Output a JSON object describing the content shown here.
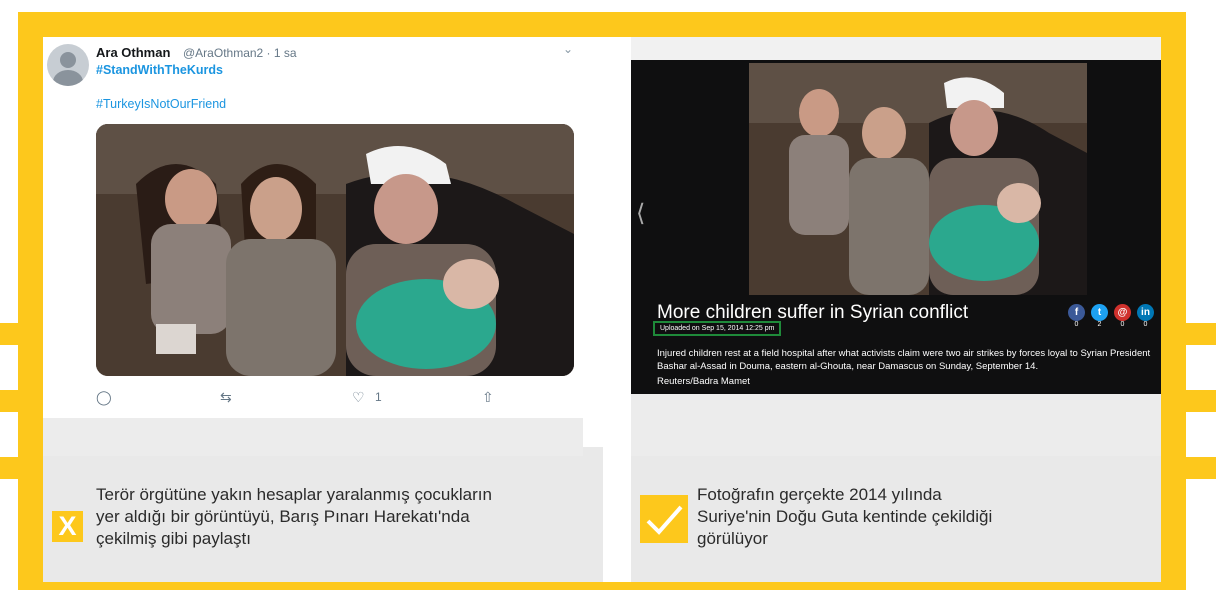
{
  "colors": {
    "frame": "#fdc81c",
    "link": "#1b95e0",
    "check_green": "#1f8a3a"
  },
  "tweet": {
    "name": "Ara Othman",
    "handle": "@AraOthman2 · 1 sa",
    "hashtag1": "#StandWithTheKurds",
    "hashtag2": "#TurkeyIsNotOurFriend",
    "like_count": "1",
    "icons": [
      "reply-icon",
      "retweet-icon",
      "like-icon",
      "share-icon",
      "chevron-down-icon"
    ]
  },
  "news": {
    "title": "More children suffer in Syrian conflict",
    "uploaded": "Uploaded on Sep 15, 2014 12:25 pm",
    "caption": "Injured children rest at a field hospital after what activists claim were two air strikes by forces loyal to Syrian President Bashar al-Assad in Douma, eastern al-Ghouta, near Damascus on Sunday, September 14.",
    "credit": "Reuters/Badra Mamet",
    "share_counts": [
      "0",
      "2",
      "0",
      "0"
    ],
    "share_icons": [
      "facebook-icon",
      "twitter-icon",
      "email-icon",
      "linkedin-icon"
    ]
  },
  "verdict": {
    "false_mark": "X",
    "false_text": "Terör örgütüne yakın hesaplar yaralanmış çocukların yer aldığı bir görüntüyü, Barış Pınarı Harekatı'nda çekilmiş gibi paylaştı",
    "true_text": "Fotoğrafın gerçekte 2014 yılında Suriye'nin Doğu Guta kentinde çekildiği görülüyor"
  }
}
